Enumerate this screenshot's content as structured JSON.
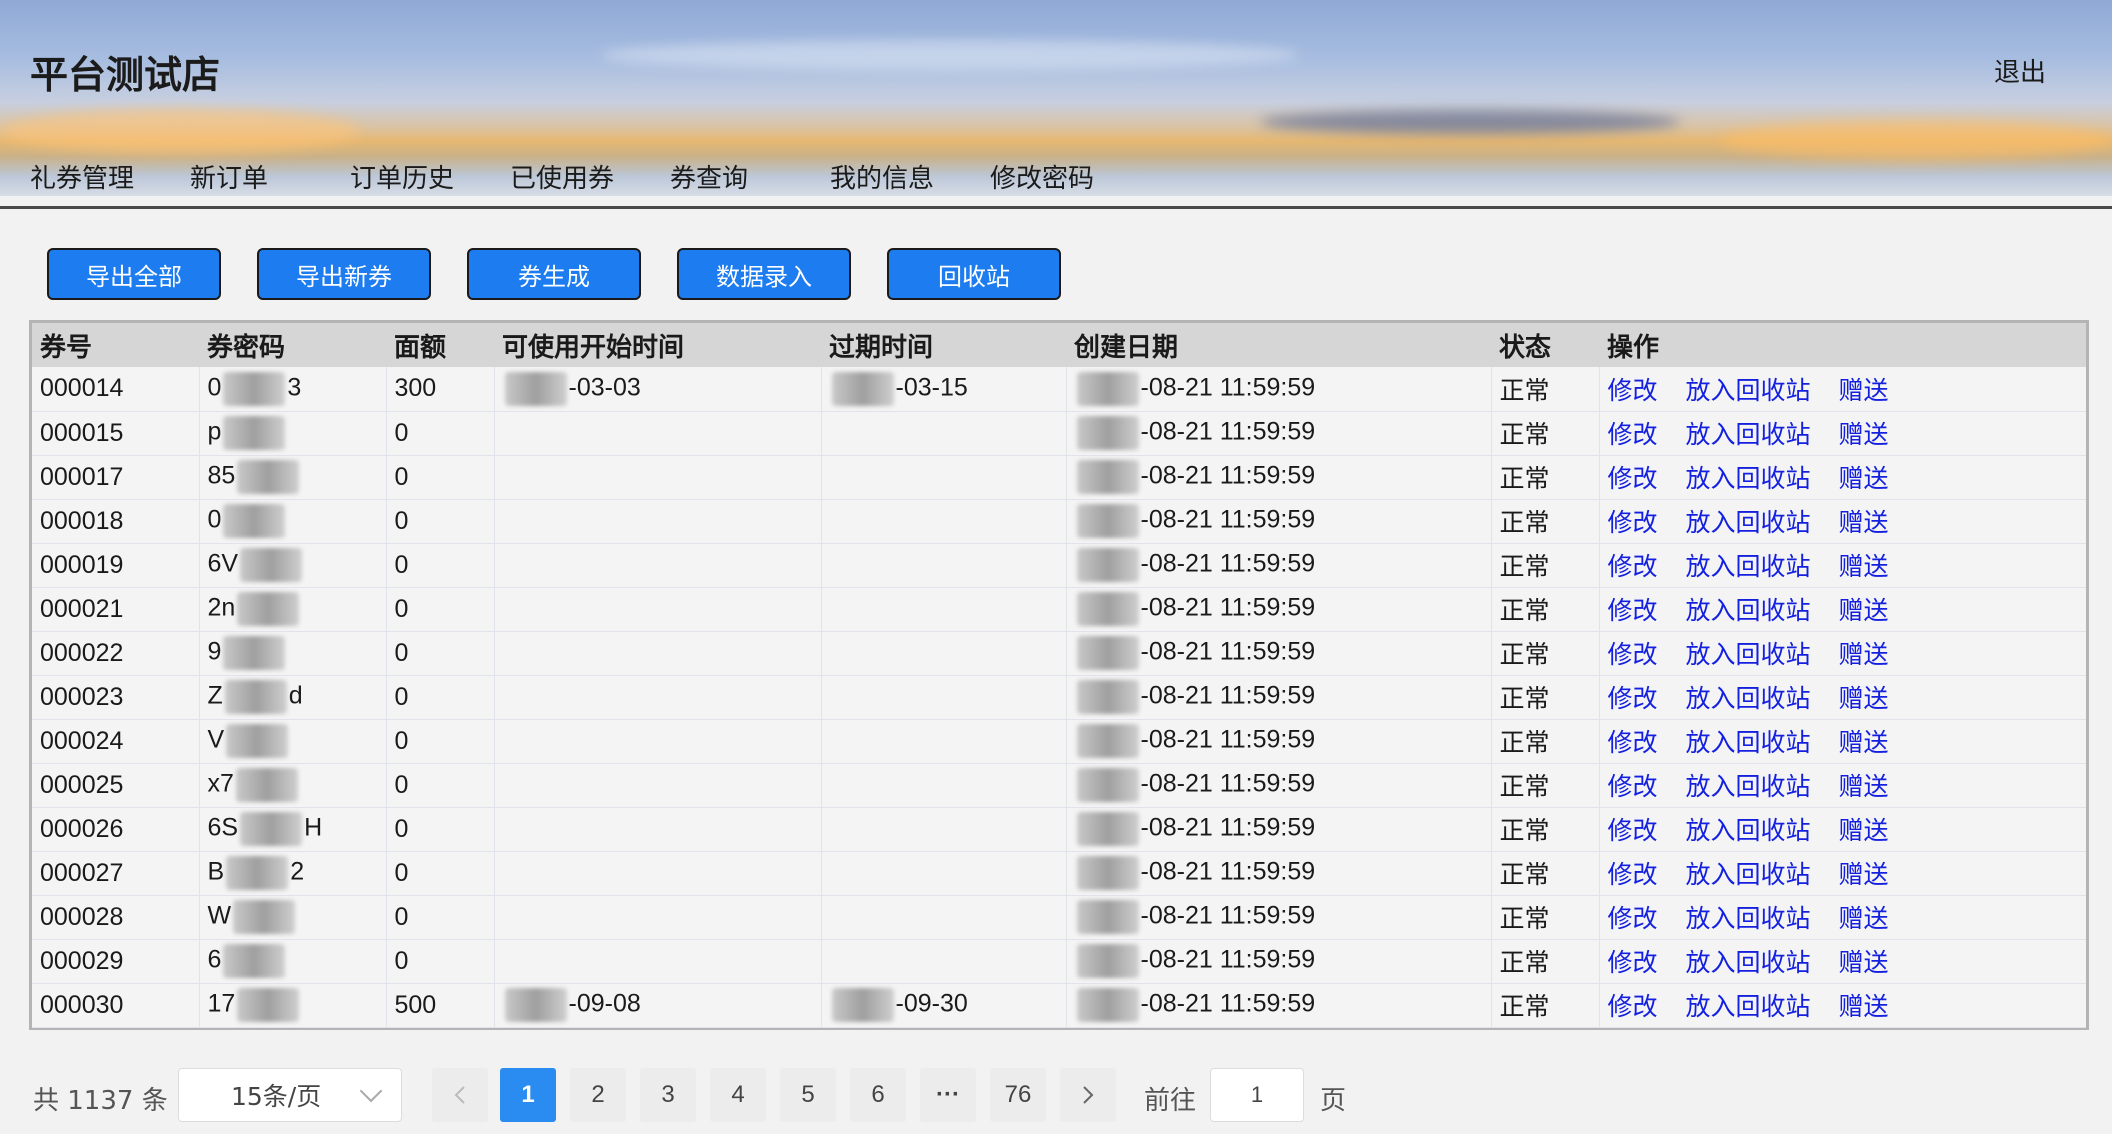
{
  "header": {
    "title": "平台测试店",
    "logout_label": "退出",
    "nav": [
      "礼券管理",
      "新订单",
      "订单历史",
      "已使用券",
      "券查询",
      "我的信息",
      "修改密码"
    ]
  },
  "toolbar": [
    "导出全部",
    "导出新券",
    "券生成",
    "数据录入",
    "回收站"
  ],
  "table": {
    "columns": [
      "券号",
      "券密码",
      "面额",
      "可使用开始时间",
      "过期时间",
      "创建日期",
      "状态",
      "操作"
    ],
    "rows": [
      {
        "no": "000014",
        "pw_pre": "0",
        "pw_post": "3",
        "amount": "300",
        "start": "-03-03",
        "expire": "-03-15",
        "created": "-08-21 11:59:59",
        "status": "正常"
      },
      {
        "no": "000015",
        "pw_pre": "p",
        "pw_post": "",
        "amount": "0",
        "start": "",
        "expire": "",
        "created": "-08-21 11:59:59",
        "status": "正常"
      },
      {
        "no": "000017",
        "pw_pre": "85",
        "pw_post": "",
        "amount": "0",
        "start": "",
        "expire": "",
        "created": "-08-21 11:59:59",
        "status": "正常"
      },
      {
        "no": "000018",
        "pw_pre": "0",
        "pw_post": "",
        "amount": "0",
        "start": "",
        "expire": "",
        "created": "-08-21 11:59:59",
        "status": "正常"
      },
      {
        "no": "000019",
        "pw_pre": "6V",
        "pw_post": "",
        "amount": "0",
        "start": "",
        "expire": "",
        "created": "-08-21 11:59:59",
        "status": "正常"
      },
      {
        "no": "000021",
        "pw_pre": "2n",
        "pw_post": "",
        "amount": "0",
        "start": "",
        "expire": "",
        "created": "-08-21 11:59:59",
        "status": "正常"
      },
      {
        "no": "000022",
        "pw_pre": "9",
        "pw_post": "",
        "amount": "0",
        "start": "",
        "expire": "",
        "created": "-08-21 11:59:59",
        "status": "正常"
      },
      {
        "no": "000023",
        "pw_pre": "Z",
        "pw_post": "d",
        "amount": "0",
        "start": "",
        "expire": "",
        "created": "-08-21 11:59:59",
        "status": "正常"
      },
      {
        "no": "000024",
        "pw_pre": "V",
        "pw_post": "",
        "amount": "0",
        "start": "",
        "expire": "",
        "created": "-08-21 11:59:59",
        "status": "正常"
      },
      {
        "no": "000025",
        "pw_pre": "x7",
        "pw_post": "",
        "amount": "0",
        "start": "",
        "expire": "",
        "created": "-08-21 11:59:59",
        "status": "正常"
      },
      {
        "no": "000026",
        "pw_pre": "6S",
        "pw_post": "H",
        "amount": "0",
        "start": "",
        "expire": "",
        "created": "-08-21 11:59:59",
        "status": "正常"
      },
      {
        "no": "000027",
        "pw_pre": "B",
        "pw_post": "2",
        "amount": "0",
        "start": "",
        "expire": "",
        "created": "-08-21 11:59:59",
        "status": "正常"
      },
      {
        "no": "000028",
        "pw_pre": "W",
        "pw_post": "",
        "amount": "0",
        "start": "",
        "expire": "",
        "created": "-08-21 11:59:59",
        "status": "正常"
      },
      {
        "no": "000029",
        "pw_pre": "6",
        "pw_post": "",
        "amount": "0",
        "start": "",
        "expire": "",
        "created": "-08-21 11:59:59",
        "status": "正常"
      },
      {
        "no": "000030",
        "pw_pre": "17",
        "pw_post": "",
        "amount": "500",
        "start": "-09-08",
        "expire": "-09-30",
        "created": "-08-21 11:59:59",
        "status": "正常"
      }
    ],
    "actions": [
      "修改",
      "放入回收站",
      "赠送"
    ]
  },
  "pagination": {
    "total_text": "共 1137 条",
    "page_size": "15条/页",
    "pages": [
      "1",
      "2",
      "3",
      "4",
      "5",
      "6",
      "···",
      "76"
    ],
    "current": "1",
    "goto_label": "前往",
    "goto_value": "1",
    "goto_unit": "页"
  },
  "colors": {
    "accent": "#1c7cf0",
    "link": "#1420e0",
    "active_page": "#2a8cf0"
  }
}
